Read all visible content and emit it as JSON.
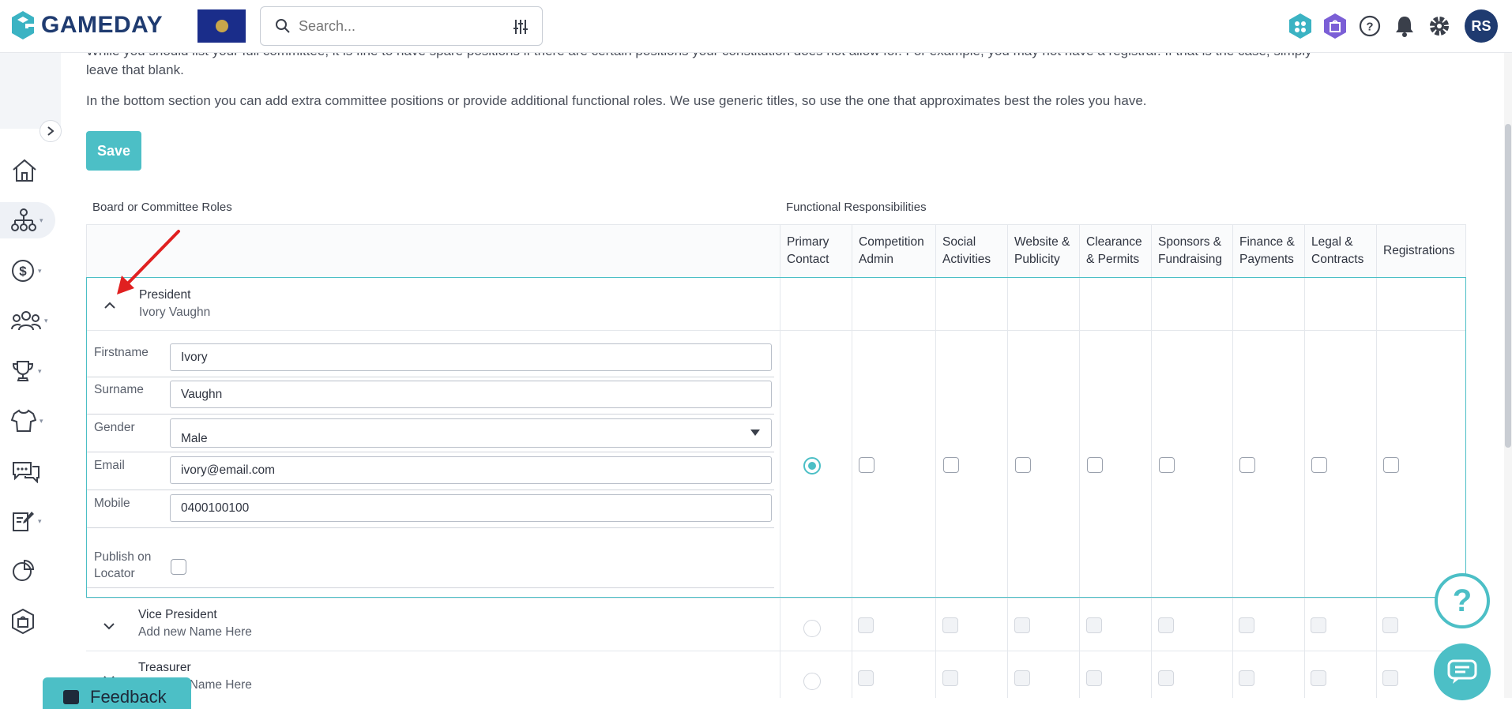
{
  "app": {
    "brand": "GAMEDAY",
    "search_placeholder": "Search...",
    "user_initials": "RS"
  },
  "content": {
    "partial_paragraph": "While you should list your full committee, it is fine to have spare positions if there are certain positions your constitution does not allow for. For example, you may not have a registrar. If that is the case, simply",
    "partial_paragraph_2": "leave that blank.",
    "paragraph": "In the bottom section you can add extra committee positions or provide additional functional roles. We use generic titles, so use the one that approximates best the roles you have.",
    "save_label": "Save",
    "roles_header": "Board or Committee Roles",
    "functional_header": "Functional Responsibilities"
  },
  "columns": [
    {
      "line1": "Primary",
      "line2": "Contact"
    },
    {
      "line1": "Competition",
      "line2": "Admin"
    },
    {
      "line1": "Social",
      "line2": "Activities"
    },
    {
      "line1": "Website &",
      "line2": "Publicity"
    },
    {
      "line1": "Clearance",
      "line2": "& Permits"
    },
    {
      "line1": "Sponsors &",
      "line2": "Fundraising"
    },
    {
      "line1": "Finance &",
      "line2": "Payments"
    },
    {
      "line1": "Legal &",
      "line2": "Contracts"
    },
    {
      "line1": "Registrations",
      "line2": ""
    }
  ],
  "roles": [
    {
      "title": "President",
      "name": "Ivory Vaughn",
      "expanded": true
    },
    {
      "title": "Vice President",
      "name": "Add new Name Here",
      "expanded": false
    },
    {
      "title": "Treasurer",
      "name": "Add new Name Here",
      "expanded": false
    }
  ],
  "president_form": {
    "firstname_label": "Firstname",
    "firstname": "Ivory",
    "surname_label": "Surname",
    "surname": "Vaughn",
    "gender_label": "Gender",
    "gender": "Male",
    "email_label": "Email",
    "email": "ivory@email.com",
    "mobile_label": "Mobile",
    "mobile": "0400100100",
    "publish_label_1": "Publish on",
    "publish_label_2": "Locator",
    "publish_checked": false
  },
  "floating": {
    "help_glyph": "?",
    "feedback_label": "Feedback"
  },
  "colors": {
    "accent": "#4cbfc6",
    "brand": "#1f3b70"
  }
}
